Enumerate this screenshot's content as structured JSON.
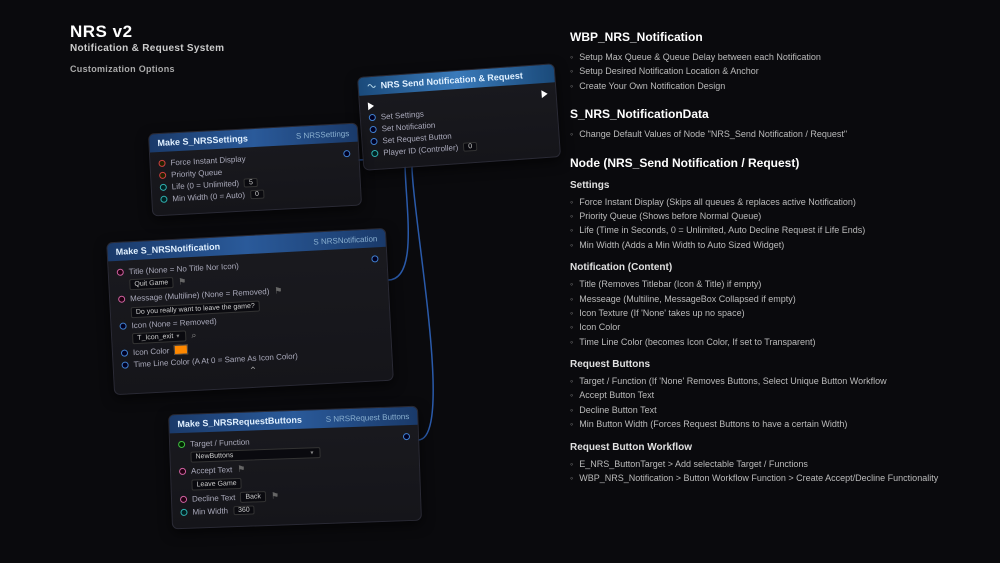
{
  "header": {
    "title": "NRS v2",
    "subtitle": "Notification & Request System",
    "subtitle2": "Customization Options"
  },
  "nodes": {
    "settings": {
      "title": "Make S_NRSSettings",
      "struct": "S NRSSettings",
      "pins": {
        "force": "Force Instant Display",
        "priority": "Priority Queue",
        "life": "Life (0 = Unlimited)",
        "life_val": "5",
        "minw": "Min Width (0 = Auto)",
        "minw_val": "0"
      }
    },
    "notification": {
      "title": "Make S_NRSNotification",
      "struct": "S NRSNotification",
      "title_label": "Title (None = No Title Nor Icon)",
      "title_val": "Quit Game",
      "message_label": "Message (Multiline) (None = Removed)",
      "message_val": "Do you really want to leave the game?",
      "icon_label": "Icon (None = Removed)",
      "icon_val": "T_Icon_exit",
      "iconcolor_label": "Icon Color",
      "timeline_label": "Time Line Color (A At 0 = Same As Icon Color)"
    },
    "request": {
      "title": "Make S_NRSRequestButtons",
      "struct": "S NRSRequest Buttons",
      "target_label": "Target / Function",
      "target_val": "NewButtons",
      "accept_label": "Accept Text",
      "accept_val": "Leave Game",
      "decline_label": "Decline Text",
      "decline_val": "Back",
      "minw_label": "Min Width",
      "minw_val": "360"
    },
    "send": {
      "title": "NRS Send Notification & Request",
      "pins": {
        "settings": "Set Settings",
        "notif": "Set Notification",
        "reqbtn": "Set Request Button",
        "player": "Player ID (Controller)",
        "player_val": "0"
      }
    }
  },
  "docs": {
    "s1": {
      "title": "WBP_NRS_Notification",
      "items": [
        "Setup Max Queue & Queue Delay between each Notification",
        "Setup Desired Notification Location & Anchor",
        "Create Your Own Notification Design"
      ]
    },
    "s2": {
      "title": "S_NRS_NotificationData",
      "items": [
        "Change Default Values of Node \"NRS_Send Notification / Request\""
      ]
    },
    "s3": {
      "title": "Node (NRS_Send Notification / Request)",
      "settings_h": "Settings",
      "settings": [
        "Force Instant Display (Skips all queues & replaces active Notification)",
        "Priority Queue (Shows before Normal Queue)",
        "Life (Time in Seconds, 0 = Unlimited, Auto Decline Request if Life Ends)",
        "Min Width (Adds a Min Width to Auto Sized Widget)"
      ],
      "content_h": "Notification (Content)",
      "content": [
        "Title (Removes Titlebar (Icon & Title) if empty)",
        "Messeage (Multiline, MessageBox Collapsed if empty)",
        "Icon Texture (If 'None' takes up no space)",
        "Icon Color",
        "Time Line Color (becomes Icon Color, If set to Transparent)"
      ],
      "req_h": "Request Buttons",
      "req": [
        "Target / Function (If 'None' Removes Buttons, Select Unique Button Workflow",
        "Accept Button Text",
        "Decline Button Text",
        "Min Button Width (Forces Request Buttons to have a certain Width)"
      ],
      "wf_h": "Request Button Workflow",
      "wf": [
        "E_NRS_ButtonTarget > Add selectable Target / Functions",
        "WBP_NRS_Notification > Button Workflow Function > Create Accept/Decline Functionality"
      ]
    }
  }
}
